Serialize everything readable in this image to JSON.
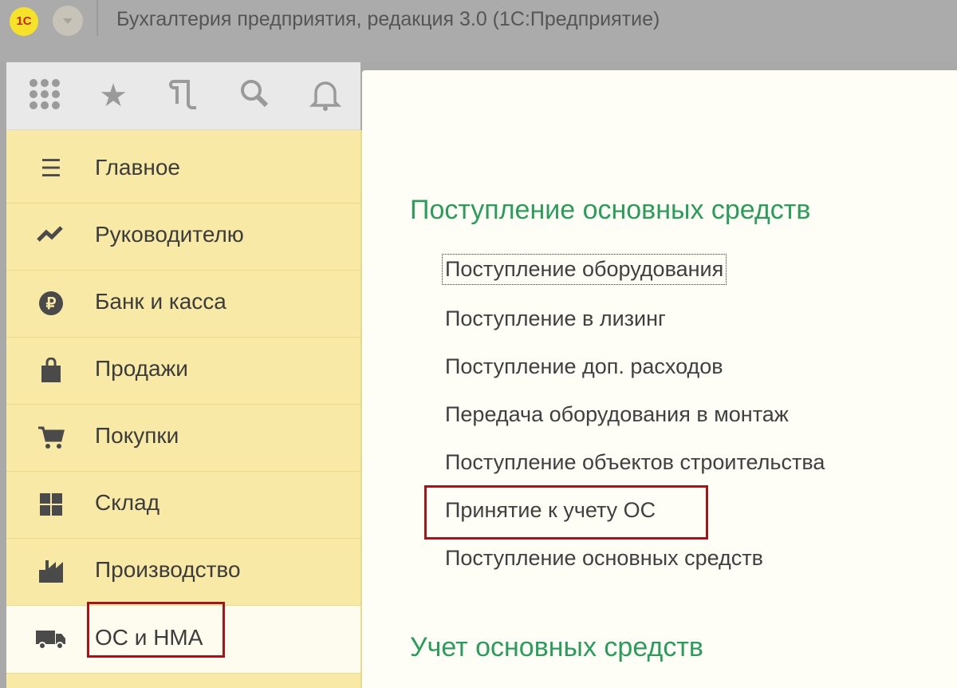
{
  "window": {
    "title": "Бухгалтерия предприятия, редакция 3.0  (1С:Предприятие)",
    "logo": "1С"
  },
  "toolbar": {
    "icons": [
      "apps-grid-icon",
      "favorites-star-icon",
      "history-icon",
      "search-icon",
      "notifications-bell-icon"
    ]
  },
  "sidebar": {
    "items": [
      {
        "label": "Главное",
        "icon": "menu-lines-icon"
      },
      {
        "label": "Руководителю",
        "icon": "trend-chart-icon"
      },
      {
        "label": "Банк и касса",
        "icon": "ruble-icon"
      },
      {
        "label": "Продажи",
        "icon": "shopping-bag-icon"
      },
      {
        "label": "Покупки",
        "icon": "cart-icon"
      },
      {
        "label": "Склад",
        "icon": "warehouse-icon"
      },
      {
        "label": "Производство",
        "icon": "factory-icon"
      },
      {
        "label": "ОС и НМА",
        "icon": "truck-icon",
        "selected": true
      }
    ]
  },
  "content": {
    "section1": {
      "title": "Поступление основных средств",
      "links": [
        "Поступление оборудования",
        "Поступление в лизинг",
        "Поступление доп. расходов",
        "Передача оборудования в монтаж",
        "Поступление объектов строительства",
        "Принятие к учету ОС",
        "Поступление основных средств"
      ]
    },
    "section2": {
      "title": "Учет основных средств"
    }
  },
  "colors": {
    "accent_green": "#2c9b5c",
    "highlight_red": "#a0161a",
    "sidebar_yellow": "#f8e9a6"
  }
}
